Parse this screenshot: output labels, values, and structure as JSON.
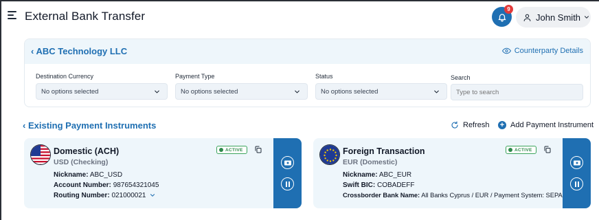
{
  "header": {
    "title": "External Bank Transfer",
    "notification_count": "9",
    "user_name": "John Smith"
  },
  "counterparty": {
    "name": "ABC Technology LLC",
    "details_link": "Counterparty Details",
    "filters": [
      {
        "label": "Destination Currency",
        "value": "No options selected"
      },
      {
        "label": "Payment Type",
        "value": "No options selected"
      },
      {
        "label": "Status",
        "value": "No options selected"
      }
    ],
    "search": {
      "label": "Search",
      "placeholder": "Type to search"
    }
  },
  "instruments": {
    "title": "Existing Payment Instruments",
    "refresh_label": "Refresh",
    "add_label": "Add Payment Instrument",
    "cards": [
      {
        "title": "Domestic (ACH)",
        "subtitle": "USD (Checking)",
        "status": "ACTIVE",
        "rows": [
          {
            "label": "Nickname:",
            "value": "ABC_USD"
          },
          {
            "label": "Account Number:",
            "value": "987654321045"
          },
          {
            "label": "Routing Number:",
            "value": "021000021"
          }
        ],
        "flag": "us-flag-icon"
      },
      {
        "title": "Foreign Transaction",
        "subtitle": "EUR (Domestic)",
        "status": "ACTIVE",
        "rows": [
          {
            "label": "Nickname:",
            "value": "ABC_EUR"
          },
          {
            "label": "Swift BIC:",
            "value": "COBADEFF"
          },
          {
            "label": "Crossborder Bank Name:",
            "value": "All Banks Cyprus / EUR / Payment System: SEPA"
          }
        ],
        "flag": "eu-flag-icon"
      }
    ]
  },
  "colors": {
    "accent": "#1f6fb2",
    "active_green": "#2f8a4b",
    "badge_red": "#e23a3a",
    "panel_bg": "#eef6fb"
  }
}
